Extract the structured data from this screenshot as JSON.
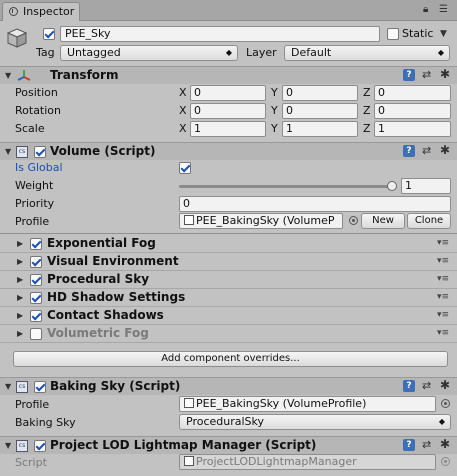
{
  "tab": {
    "label": "Inspector"
  },
  "object": {
    "name": "PEE_Sky",
    "static_label": "Static",
    "tag_label": "Tag",
    "tag_value": "Untagged",
    "layer_label": "Layer",
    "layer_value": "Default"
  },
  "transform": {
    "title": "Transform",
    "rows": [
      {
        "label": "Position",
        "x": "0",
        "y": "0",
        "z": "0"
      },
      {
        "label": "Rotation",
        "x": "0",
        "y": "0",
        "z": "0"
      },
      {
        "label": "Scale",
        "x": "1",
        "y": "1",
        "z": "1"
      }
    ],
    "axis_x": "X",
    "axis_y": "Y",
    "axis_z": "Z"
  },
  "volume": {
    "title": "Volume (Script)",
    "is_global_label": "Is Global",
    "weight_label": "Weight",
    "weight_value": "1",
    "weight_fraction": 1.0,
    "priority_label": "Priority",
    "priority_value": "0",
    "profile_label": "Profile",
    "profile_value": "PEE_BakingSky (VolumeP",
    "new_label": "New",
    "clone_label": "Clone",
    "overrides": [
      {
        "label": "Exponential Fog",
        "enabled": true
      },
      {
        "label": "Visual Environment",
        "enabled": true
      },
      {
        "label": "Procedural Sky",
        "enabled": true
      },
      {
        "label": "HD Shadow Settings",
        "enabled": true
      },
      {
        "label": "Contact Shadows",
        "enabled": true
      },
      {
        "label": "Volumetric Fog",
        "enabled": false
      }
    ],
    "add_overrides_label": "Add component overrides..."
  },
  "baking_sky": {
    "title": "Baking Sky (Script)",
    "profile_label": "Profile",
    "profile_value": "PEE_BakingSky (VolumeProfile)",
    "baking_label": "Baking Sky",
    "baking_value": "ProceduralSky"
  },
  "lod": {
    "title": "Project LOD Lightmap Manager (Script)",
    "script_label": "Script",
    "script_value": "ProjectLODLightmapManager"
  },
  "icons": {
    "help": "book-icon",
    "preset": "preset-icon",
    "settings": "gear-icon",
    "script": "script-icon"
  }
}
